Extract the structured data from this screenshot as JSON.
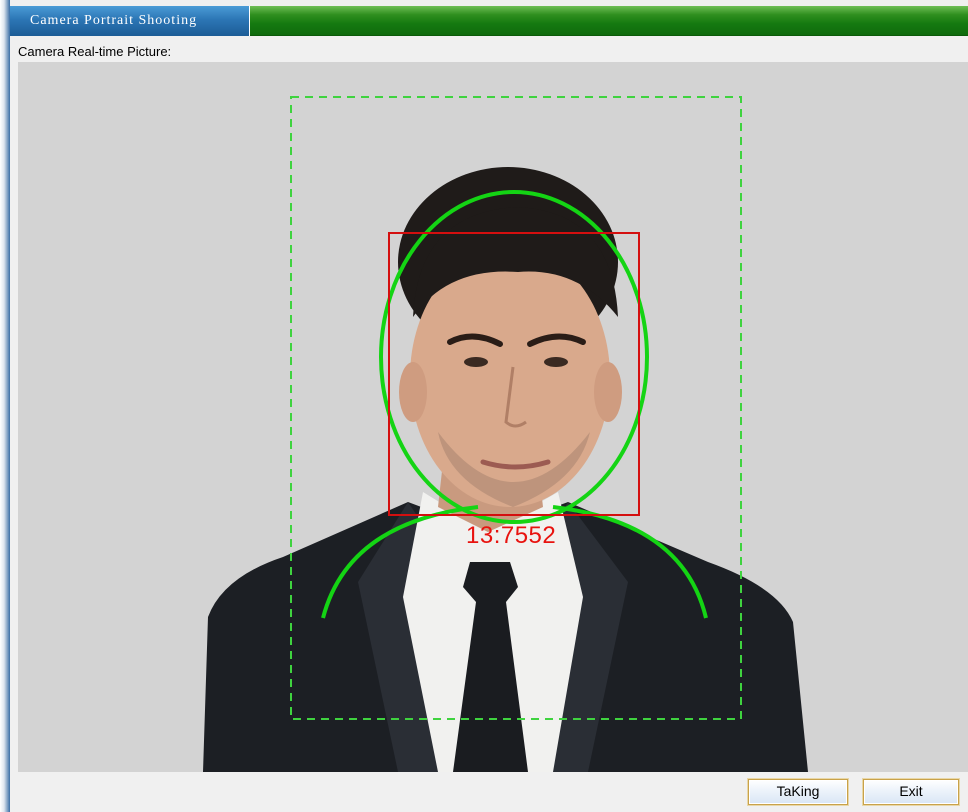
{
  "window": {
    "title": "Camera Portrait Shooting"
  },
  "camera": {
    "label": "Camera Real-time Picture:",
    "face_score": "13:7552",
    "overlay_colors": {
      "guide_frame": "#3fd33f",
      "face_outline": "#14d414",
      "face_box": "#d40f0f",
      "score_text": "#e8130f",
      "background": "#d3d3d3"
    }
  },
  "buttons": {
    "taking_label": "TaKing",
    "exit_label": "Exit"
  }
}
